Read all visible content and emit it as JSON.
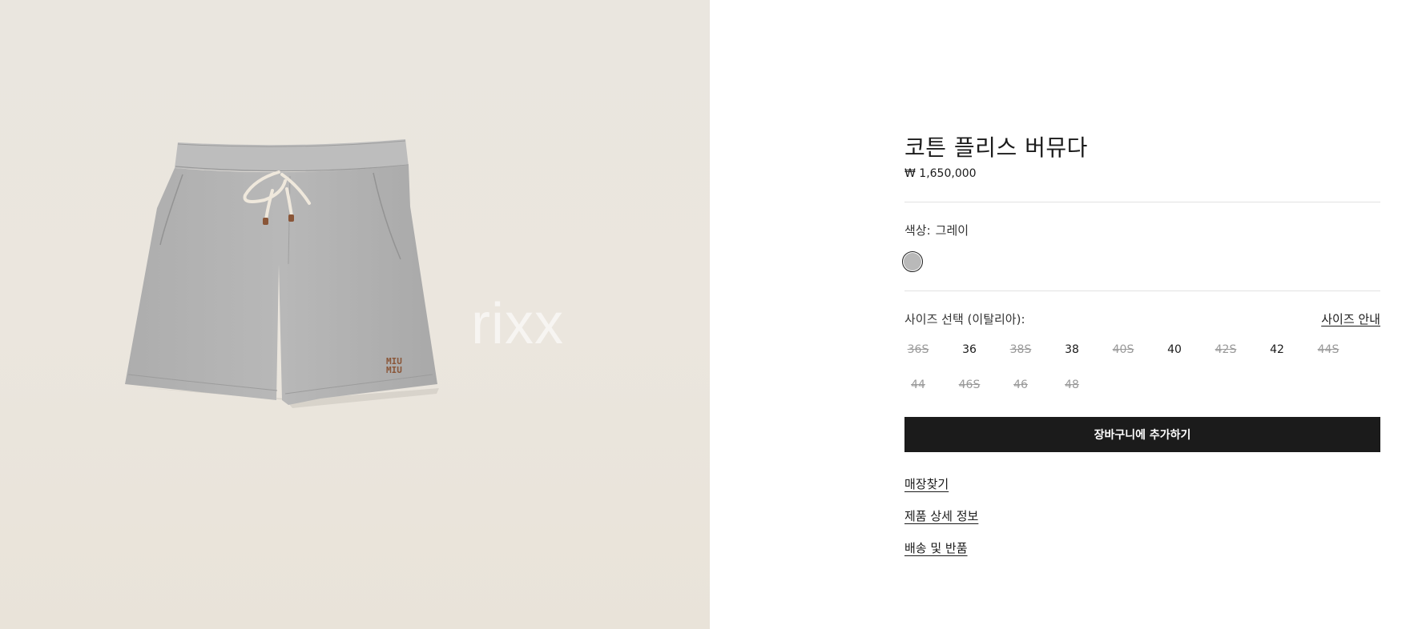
{
  "product": {
    "title": "코튼 플리스 버뮤다",
    "price": "₩ 1,650,000",
    "image_alt": "gray cotton fleece bermuda shorts with drawstring",
    "logo_text": "MIU MIU",
    "watermark": "rixx"
  },
  "color": {
    "label": "색상:",
    "value": "그레이",
    "swatch_color": "#b9b9b9"
  },
  "size": {
    "label": "사이즈 선택 (이탈리아):",
    "guide_label": "사이즈 안내",
    "options": [
      {
        "label": "36S",
        "available": false
      },
      {
        "label": "36",
        "available": true
      },
      {
        "label": "38S",
        "available": false
      },
      {
        "label": "38",
        "available": true
      },
      {
        "label": "40S",
        "available": false
      },
      {
        "label": "40",
        "available": true
      },
      {
        "label": "42S",
        "available": false
      },
      {
        "label": "42",
        "available": true
      },
      {
        "label": "44S",
        "available": false
      },
      {
        "label": "44",
        "available": false
      },
      {
        "label": "46S",
        "available": false
      },
      {
        "label": "46",
        "available": false
      },
      {
        "label": "48",
        "available": false
      }
    ]
  },
  "cart_button": "장바구니에 추가하기",
  "links": {
    "store": "매장찾기",
    "details": "제품 상세 정보",
    "shipping": "배송 및 반품"
  },
  "colors": {
    "button_bg": "#1b1b1b",
    "panel_bg": "#eae6df",
    "shorts_gray": "#b3b3b3",
    "logo_brown": "#8a5638"
  }
}
